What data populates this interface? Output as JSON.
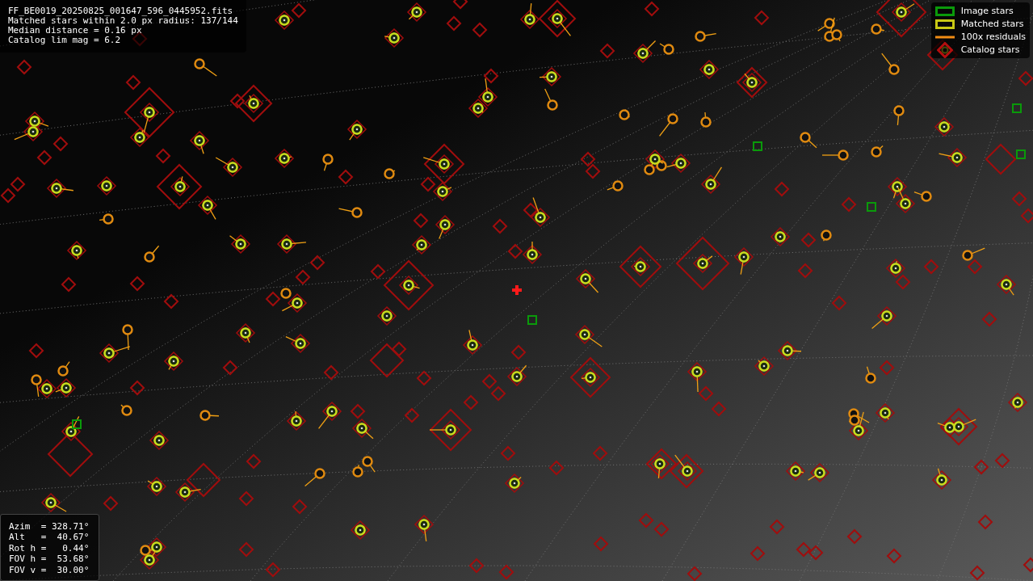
{
  "header": {
    "lines": [
      "FF_BE0019_20250825_001647_596_0445952.fits",
      "Matched stars within 2.0 px radius: 137/144",
      "Median distance = 0.16 px",
      "Catalog lim mag = 6.2"
    ]
  },
  "legend": [
    {
      "label": "Image stars",
      "kind": "box",
      "color": "#0a9a0a"
    },
    {
      "label": "Matched stars",
      "kind": "box",
      "color": "#c8c814"
    },
    {
      "label": "100x residuals",
      "kind": "line",
      "color": "#f08c14"
    },
    {
      "label": "Catalog stars",
      "kind": "diamond",
      "color": "#b40f0f"
    }
  ],
  "pointing": {
    "lines": [
      "Azim  = 328.71°",
      "Alt   =  40.67°",
      "Rot h =   0.44°",
      "FOV h =  53.68°",
      "FOV v =  30.00°"
    ]
  }
}
